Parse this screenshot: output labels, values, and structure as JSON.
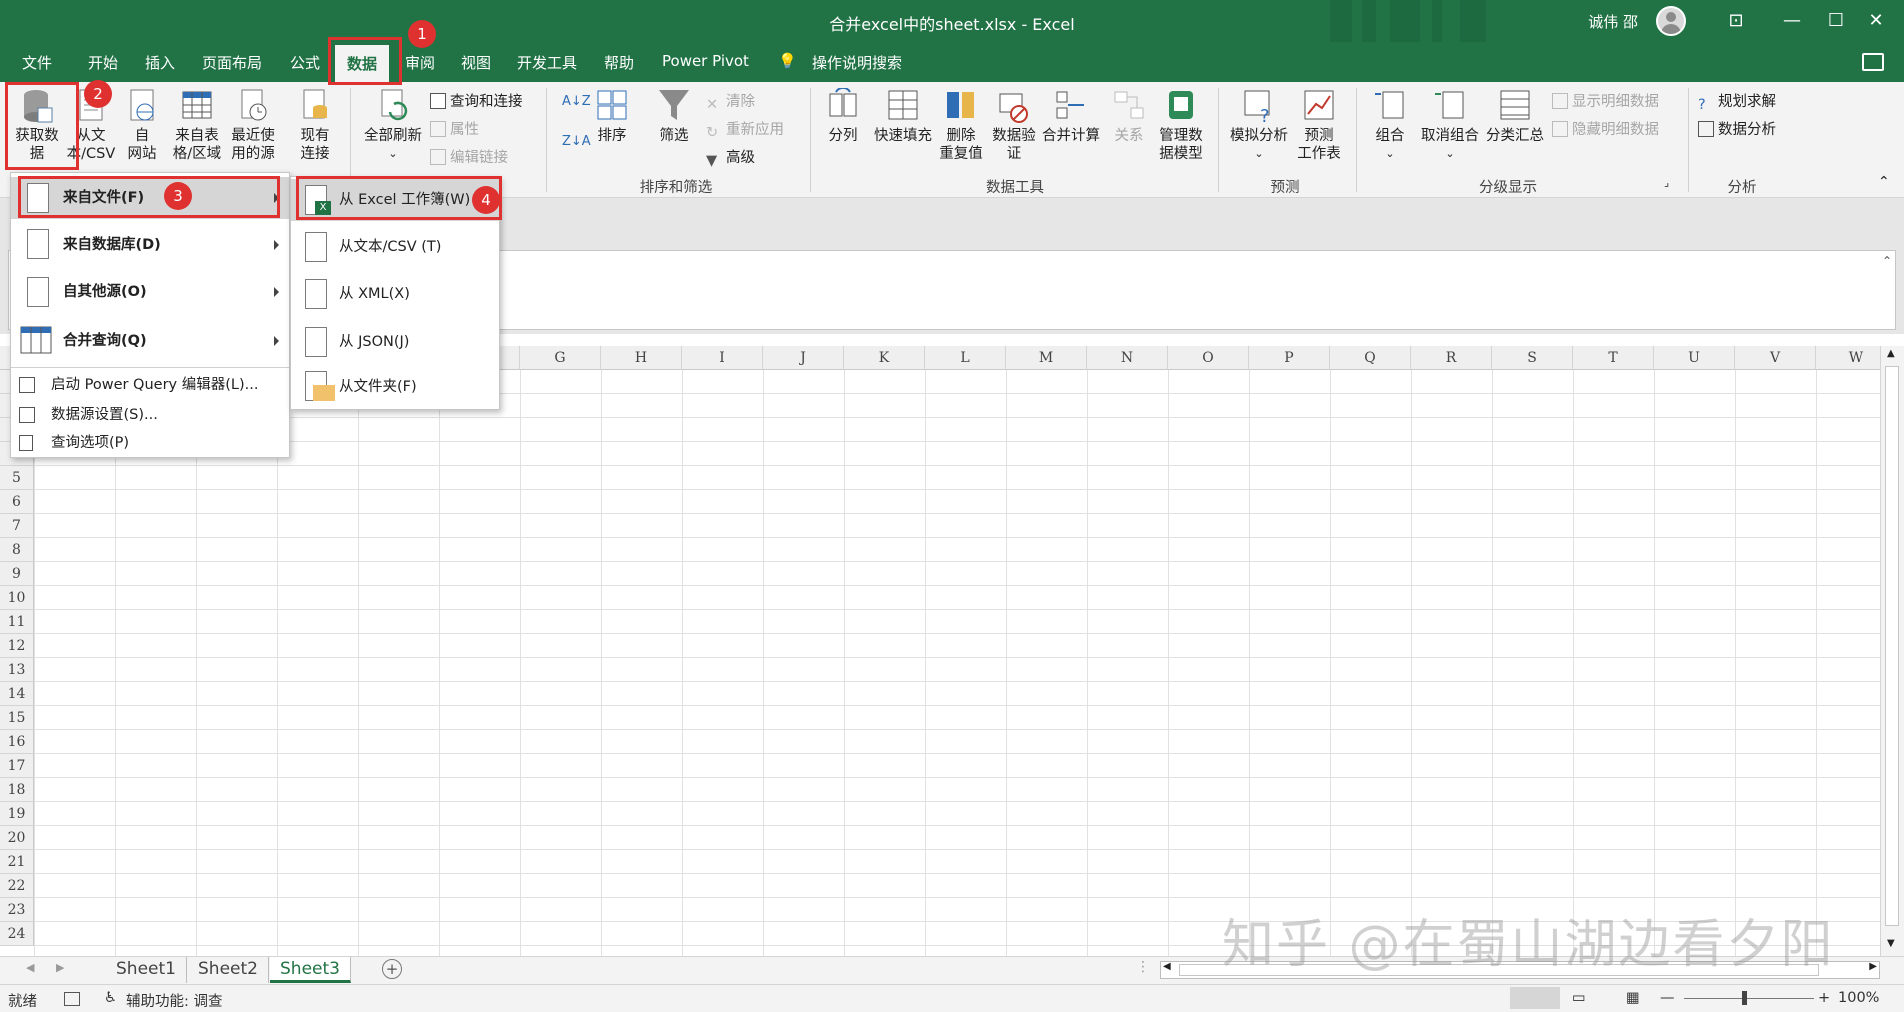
{
  "window": {
    "title": "合并excel中的sheet.xlsx  -  Excel",
    "user": "诚伟 邵"
  },
  "tabs": [
    "文件",
    "开始",
    "插入",
    "页面布局",
    "公式",
    "数据",
    "审阅",
    "视图",
    "开发工具",
    "帮助",
    "Power Pivot",
    "操作说明搜索"
  ],
  "ribbon": {
    "get_data": "获取数\n据",
    "from_text": "从文\n本/CSV",
    "from_web": "自\n网站",
    "from_table": "来自表\n格/区域",
    "recent": "最近使\n用的源",
    "existing": "现有\n连接",
    "refresh_all": "全部刷新",
    "query_conn": "查询和连接",
    "properties": "属性",
    "edit_links": "编辑链接",
    "sort": "排序",
    "filter": "筛选",
    "clear": "清除",
    "reapply": "重新应用",
    "advanced": "高级",
    "sort_filter_group": "排序和筛选",
    "split": "分列",
    "flash_fill": "快速填充",
    "remove_dup": "删除\n重复值",
    "validation": "数据验\n证",
    "consolidate": "合并计算",
    "relations": "关系",
    "data_model": "管理数\n据模型",
    "data_tools_group": "数据工具",
    "what_if": "模拟分析",
    "forecast_sheet": "预测\n工作表",
    "forecast_group": "预测",
    "group": "组合",
    "ungroup": "取消组合",
    "subtotal": "分类汇总",
    "show_detail": "显示明细数据",
    "hide_detail": "隐藏明细数据",
    "outline_group": "分级显示",
    "solver": "规划求解",
    "data_analysis": "数据分析",
    "analysis_group": "分析"
  },
  "menu1": [
    {
      "label": "来自文件(F)"
    },
    {
      "label": "来自数据库(D)"
    },
    {
      "label": "自其他源(O)"
    },
    {
      "label": "合并查询(Q)"
    },
    {
      "label": "启动 Power Query 编辑器(L)..."
    },
    {
      "label": "数据源设置(S)..."
    },
    {
      "label": "查询选项(P)"
    }
  ],
  "menu2": [
    {
      "label": "从 Excel 工作簿(W)"
    },
    {
      "label": "从文本/CSV (T)"
    },
    {
      "label": "从 XML(X)"
    },
    {
      "label": "从 JSON(J)"
    },
    {
      "label": "从文件夹(F)"
    }
  ],
  "columns": [
    "G",
    "H",
    "I",
    "J",
    "K",
    "L",
    "M",
    "N",
    "O",
    "P",
    "Q",
    "R",
    "S",
    "T",
    "U",
    "V",
    "W"
  ],
  "rows": [
    "5",
    "6",
    "7",
    "8",
    "9",
    "10",
    "11",
    "12",
    "13",
    "14",
    "15",
    "16",
    "17",
    "18",
    "19",
    "20",
    "21",
    "22",
    "23",
    "24"
  ],
  "sheets": [
    "Sheet1",
    "Sheet2",
    "Sheet3"
  ],
  "status": {
    "ready": "就绪",
    "accessibility": "辅助功能: 调查",
    "zoom": "100%"
  },
  "badges": [
    "1",
    "2",
    "3",
    "4"
  ],
  "watermark": "知乎 @在蜀山湖边看夕阳",
  "colors": {
    "accent": "#217346",
    "annotation": "#e03131"
  }
}
